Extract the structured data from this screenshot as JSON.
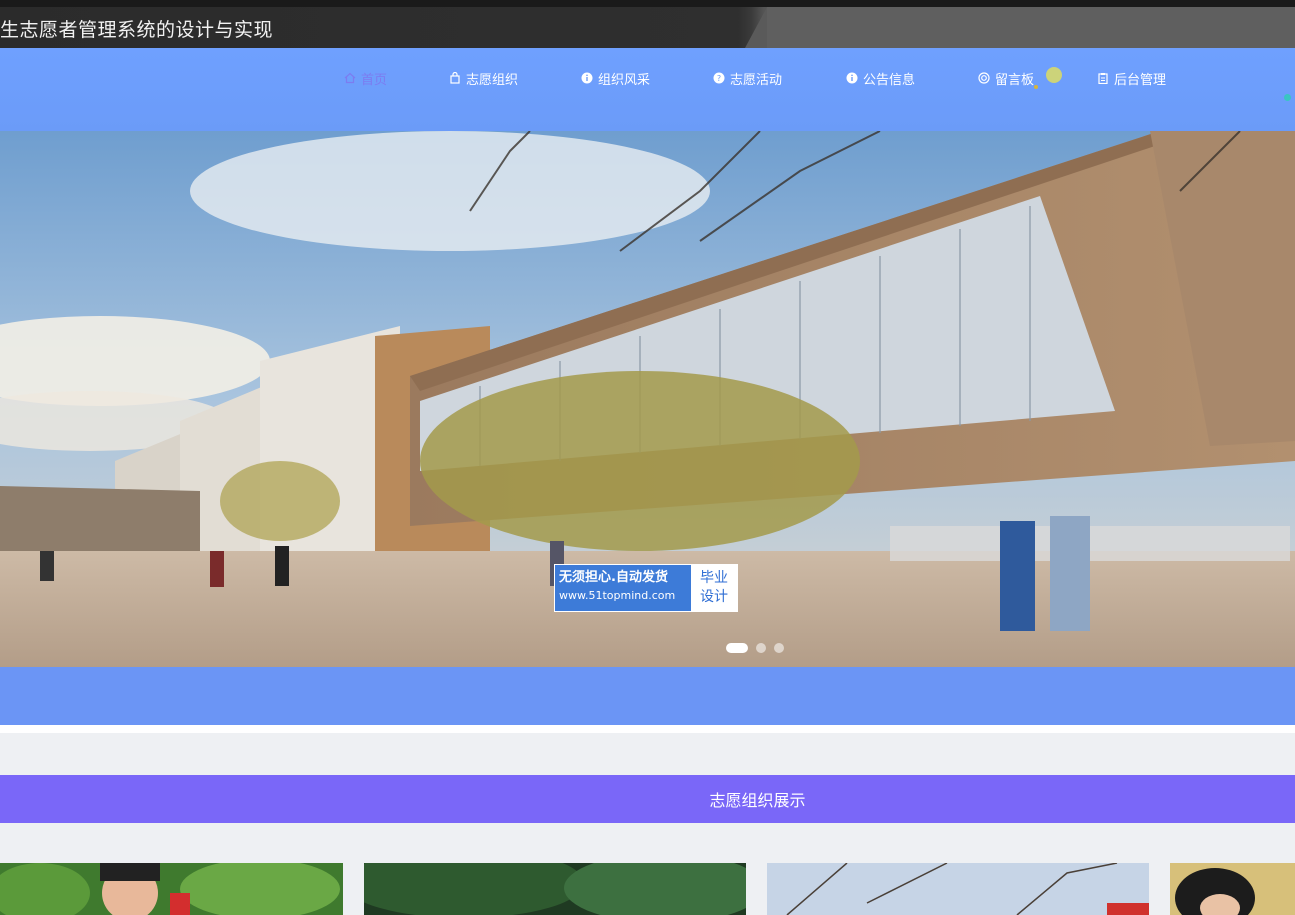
{
  "site": {
    "title": "生志愿者管理系统的设计与实现"
  },
  "nav": {
    "items": [
      {
        "label": "首页",
        "icon": "home-icon",
        "active": true
      },
      {
        "label": "志愿组织",
        "icon": "bag-icon",
        "active": false
      },
      {
        "label": "组织风采",
        "icon": "info-circle-icon",
        "active": false
      },
      {
        "label": "志愿活动",
        "icon": "help-circle-icon",
        "active": false
      },
      {
        "label": "公告信息",
        "icon": "info-circle-icon",
        "active": false
      },
      {
        "label": "留言板",
        "icon": "target-icon",
        "active": false
      },
      {
        "label": "后台管理",
        "icon": "clipboard-icon",
        "active": false
      }
    ]
  },
  "banner": {
    "watermark": {
      "line1": "无须担心.自动发货",
      "line2": "www.51topmind.com",
      "tag_line1": "毕业",
      "tag_line2": "设计"
    },
    "slides": 3,
    "active_slide": 1
  },
  "section": {
    "title": "志愿组织展示"
  },
  "colors": {
    "nav_bg": "#6b9bf8",
    "active_nav": "#7c7cf0",
    "section_header": "#7a67f8",
    "blue_band": "#6b95f5",
    "title_bar": "#2b2b2b"
  }
}
